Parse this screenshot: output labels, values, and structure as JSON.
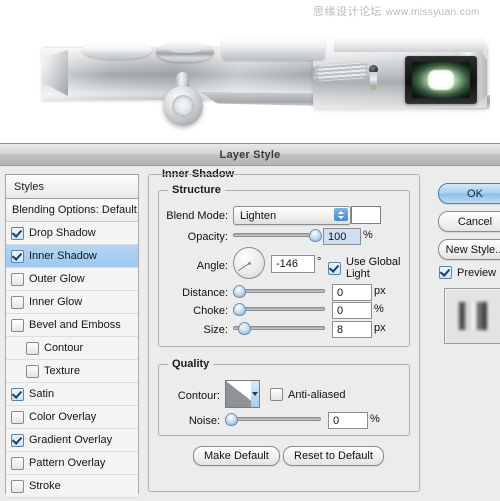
{
  "watermark": {
    "cn_text": "思缘设计论坛",
    "url_text": "www.missyuan.com"
  },
  "photo": {
    "alt": "silver camera body with viewfinder",
    "name": "camera-photo"
  },
  "dialog": {
    "title": "Layer Style",
    "styles_panel": {
      "header": "Styles",
      "blending_options": "Blending Options: Default",
      "items": [
        {
          "label": "Drop Shadow",
          "checked": true,
          "indent": false,
          "selected": false
        },
        {
          "label": "Inner Shadow",
          "checked": true,
          "indent": false,
          "selected": true
        },
        {
          "label": "Outer Glow",
          "checked": false,
          "indent": false,
          "selected": false
        },
        {
          "label": "Inner Glow",
          "checked": false,
          "indent": false,
          "selected": false
        },
        {
          "label": "Bevel and Emboss",
          "checked": false,
          "indent": false,
          "selected": false
        },
        {
          "label": "Contour",
          "checked": false,
          "indent": true,
          "selected": false
        },
        {
          "label": "Texture",
          "checked": false,
          "indent": true,
          "selected": false
        },
        {
          "label": "Satin",
          "checked": true,
          "indent": false,
          "selected": false
        },
        {
          "label": "Color Overlay",
          "checked": false,
          "indent": false,
          "selected": false
        },
        {
          "label": "Gradient Overlay",
          "checked": true,
          "indent": false,
          "selected": false
        },
        {
          "label": "Pattern Overlay",
          "checked": false,
          "indent": false,
          "selected": false
        },
        {
          "label": "Stroke",
          "checked": false,
          "indent": false,
          "selected": false
        }
      ]
    },
    "effect_panel": {
      "group_title": "Inner Shadow",
      "structure": {
        "title": "Structure",
        "blend_mode_label": "Blend Mode:",
        "blend_mode_value": "Lighten",
        "blend_color": "#ffffff",
        "opacity_label": "Opacity:",
        "opacity_value": "100",
        "opacity_unit": "%",
        "opacity_percent": 100,
        "angle_label": "Angle:",
        "angle_value": "-146",
        "angle_unit": "°",
        "angle_degrees": -146,
        "global_light_label": "Use Global Light",
        "global_light_checked": true,
        "distance_label": "Distance:",
        "distance_value": "0",
        "distance_unit": "px",
        "distance_percent": 0,
        "choke_label": "Choke:",
        "choke_value": "0",
        "choke_unit": "%",
        "choke_percent": 0,
        "size_label": "Size:",
        "size_value": "8",
        "size_unit": "px",
        "size_percent": 5
      },
      "quality": {
        "title": "Quality",
        "contour_label": "Contour:",
        "anti_aliased_label": "Anti-aliased",
        "anti_aliased_checked": false,
        "noise_label": "Noise:",
        "noise_value": "0",
        "noise_unit": "%",
        "noise_percent": 0
      },
      "make_default_label": "Make Default",
      "reset_default_label": "Reset to Default"
    },
    "actions": {
      "ok_label": "OK",
      "cancel_label": "Cancel",
      "new_style_label": "New Style...",
      "preview_label": "Preview",
      "preview_checked": true
    }
  },
  "colors": {
    "dialog_bg": "#ececec",
    "selection_blue": "#a8cef2",
    "accent_blue": "#4c89cc",
    "field_selected": "#cfe0f2"
  }
}
